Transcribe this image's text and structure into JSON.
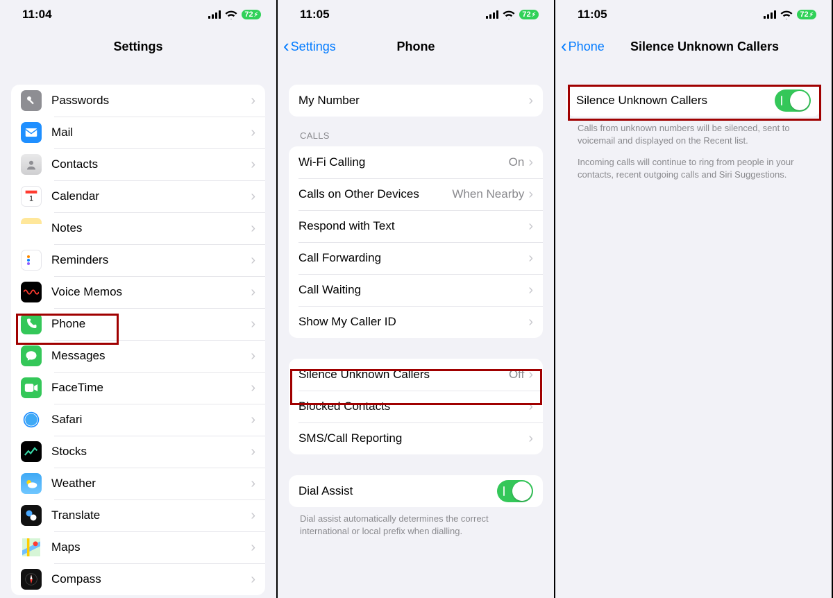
{
  "status": {
    "battery": "72",
    "bolt": "⚡︎"
  },
  "screen1": {
    "time": "11:04",
    "title": "Settings",
    "items": [
      {
        "label": "Passwords",
        "icon": "passwords"
      },
      {
        "label": "Mail",
        "icon": "mail"
      },
      {
        "label": "Contacts",
        "icon": "contacts"
      },
      {
        "label": "Calendar",
        "icon": "calendar"
      },
      {
        "label": "Notes",
        "icon": "notes"
      },
      {
        "label": "Reminders",
        "icon": "reminders"
      },
      {
        "label": "Voice Memos",
        "icon": "voicememos"
      },
      {
        "label": "Phone",
        "icon": "phone"
      },
      {
        "label": "Messages",
        "icon": "messages"
      },
      {
        "label": "FaceTime",
        "icon": "facetime"
      },
      {
        "label": "Safari",
        "icon": "safari"
      },
      {
        "label": "Stocks",
        "icon": "stocks"
      },
      {
        "label": "Weather",
        "icon": "weather"
      },
      {
        "label": "Translate",
        "icon": "translate"
      },
      {
        "label": "Maps",
        "icon": "maps"
      },
      {
        "label": "Compass",
        "icon": "compass"
      }
    ]
  },
  "screen2": {
    "time": "11:05",
    "back": "Settings",
    "title": "Phone",
    "group1": [
      {
        "label": "My Number",
        "value": ""
      }
    ],
    "calls_header": "CALLS",
    "group2": [
      {
        "label": "Wi-Fi Calling",
        "value": "On"
      },
      {
        "label": "Calls on Other Devices",
        "value": "When Nearby"
      },
      {
        "label": "Respond with Text",
        "value": ""
      },
      {
        "label": "Call Forwarding",
        "value": ""
      },
      {
        "label": "Call Waiting",
        "value": ""
      },
      {
        "label": "Show My Caller ID",
        "value": ""
      }
    ],
    "group3": [
      {
        "label": "Silence Unknown Callers",
        "value": "Off"
      },
      {
        "label": "Blocked Contacts",
        "value": ""
      },
      {
        "label": "SMS/Call Reporting",
        "value": ""
      }
    ],
    "group4": [
      {
        "label": "Dial Assist",
        "toggle": true
      }
    ],
    "dial_assist_footer": "Dial assist automatically determines the correct international or local prefix when dialling."
  },
  "screen3": {
    "time": "11:05",
    "back": "Phone",
    "title": "Silence Unknown Callers",
    "row_label": "Silence Unknown Callers",
    "footer1": "Calls from unknown numbers will be silenced, sent to voicemail and displayed on the Recent list.",
    "footer2": "Incoming calls will continue to ring from people in your contacts, recent outgoing calls and Siri Suggestions."
  }
}
